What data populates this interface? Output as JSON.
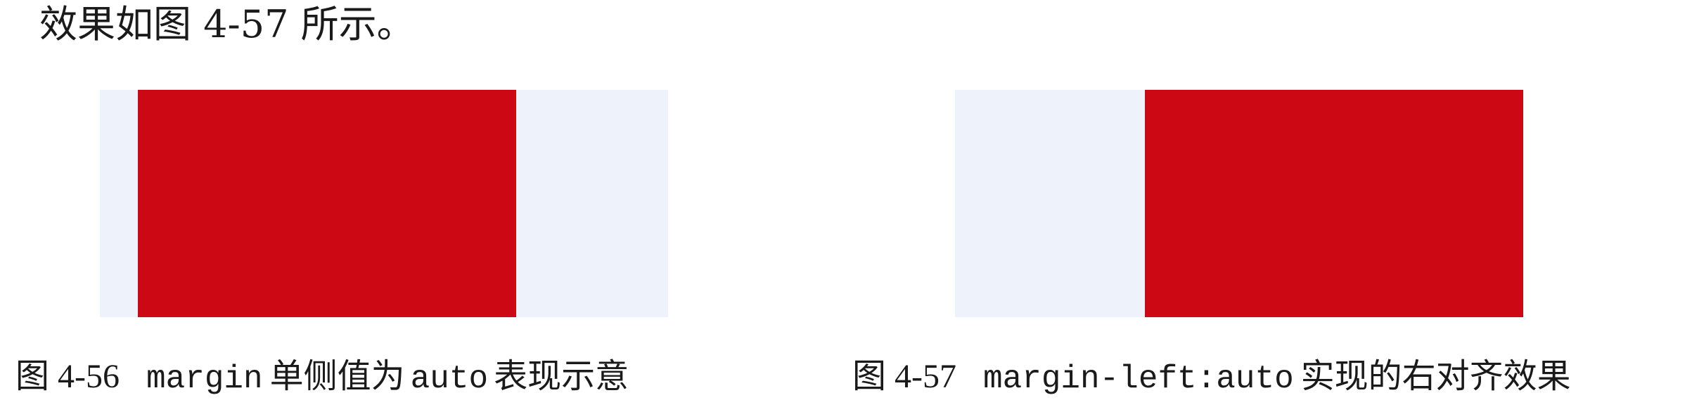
{
  "intro": {
    "text": "效果如图 4-57 所示。"
  },
  "figures": [
    {
      "number": "图 4-56",
      "code": "margin",
      "text_before": "单侧值为",
      "code2": "auto",
      "text_after": "表现示意"
    },
    {
      "number": "图 4-57",
      "code": "margin-left:auto",
      "text_after": "实现的右对齐效果"
    }
  ],
  "colors": {
    "container": "#eef2fa",
    "box": "#cb0814"
  }
}
